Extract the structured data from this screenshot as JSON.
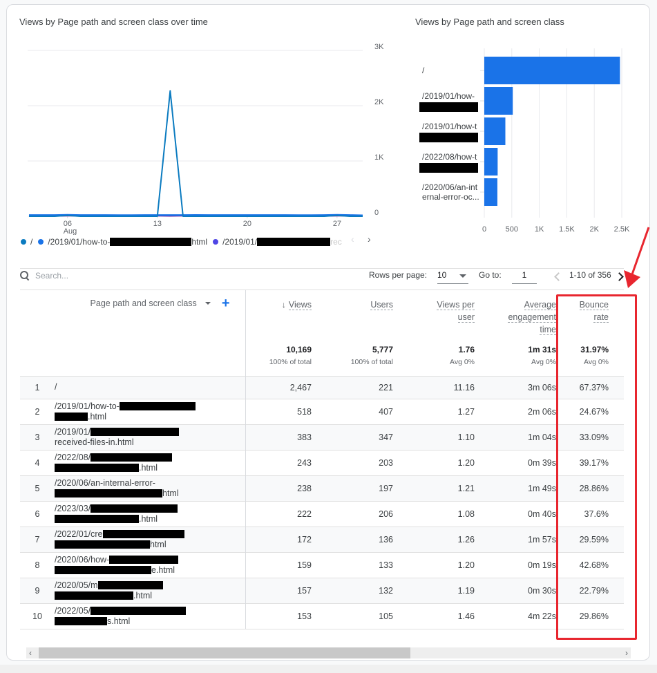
{
  "line_chart": {
    "title": "Views by Page path and screen class over time",
    "legend": [
      {
        "label_visible": "/",
        "color": "#0b7bc0"
      },
      {
        "label_prefix": "/2019/01/how-to-",
        "label_suffix": "html",
        "redacted": true,
        "color": "#1a73e8"
      },
      {
        "label_prefix": "/2019/01/",
        "label_suffix": "rec",
        "redacted": true,
        "color": "#4f46e5"
      }
    ],
    "legend_prev_icon": "‹",
    "legend_next_icon": "›"
  },
  "bar_chart": {
    "title": "Views by Page path and screen class"
  },
  "chart_data": [
    {
      "type": "line",
      "title": "Views by Page path and screen class over time",
      "x": [
        "Aug 03",
        "Aug 04",
        "Aug 05",
        "Aug 06",
        "Aug 07",
        "Aug 08",
        "Aug 09",
        "Aug 10",
        "Aug 11",
        "Aug 12",
        "Aug 13",
        "Aug 14",
        "Aug 15",
        "Aug 16",
        "Aug 17",
        "Aug 18",
        "Aug 19",
        "Aug 20",
        "Aug 21",
        "Aug 22",
        "Aug 23",
        "Aug 24",
        "Aug 25",
        "Aug 26",
        "Aug 27",
        "Aug 28",
        "Aug 29"
      ],
      "x_tick_labels": [
        {
          "x": "Aug 06",
          "label": "06",
          "sublabel": "Aug"
        },
        {
          "x": "Aug 13",
          "label": "13"
        },
        {
          "x": "Aug 20",
          "label": "20"
        },
        {
          "x": "Aug 27",
          "label": "27"
        }
      ],
      "y_ticks": [
        "0",
        "1K",
        "2K",
        "3K"
      ],
      "ylim": [
        0,
        3000
      ],
      "y_axis_side": "right",
      "grid": true,
      "series": [
        {
          "name": "/",
          "color": "#0b7bc0",
          "values": [
            0,
            0,
            0,
            15,
            0,
            0,
            0,
            0,
            0,
            0,
            0,
            2270,
            0,
            0,
            0,
            0,
            0,
            0,
            0,
            0,
            0,
            0,
            0,
            0,
            15,
            0,
            0
          ]
        },
        {
          "name": "/2019/01/how-to-…html",
          "color": "#1a73e8",
          "values": [
            20,
            20,
            20,
            25,
            20,
            20,
            20,
            18,
            18,
            20,
            20,
            20,
            20,
            22,
            20,
            20,
            20,
            20,
            20,
            20,
            20,
            18,
            18,
            20,
            25,
            20,
            15
          ]
        },
        {
          "name": "/2019/01/…rec",
          "color": "#6a1b9a",
          "values": [
            12,
            12,
            10,
            12,
            12,
            10,
            10,
            8,
            8,
            10,
            12,
            10,
            12,
            15,
            14,
            12,
            10,
            10,
            10,
            10,
            10,
            8,
            10,
            10,
            12,
            12,
            5
          ]
        }
      ]
    },
    {
      "type": "bar",
      "orientation": "horizontal",
      "title": "Views by Page path and screen class",
      "categories": [
        "/",
        "/2019/01/how-…",
        "/2019/01/how-t…",
        "/2022/08/how-t…",
        "/2020/06/an-internal-error-oc..."
      ],
      "category_labels": [
        {
          "line1": "/",
          "redacted_line2": false
        },
        {
          "line1": "/2019/01/how-",
          "redacted_line2": true
        },
        {
          "line1": "/2019/01/how-t",
          "redacted_line2": true
        },
        {
          "line1": "/2022/08/how-t",
          "redacted_line2": true
        },
        {
          "line1": "/2020/06/an-int",
          "line2": "ernal-error-oc...",
          "redacted_line2": false
        }
      ],
      "values": [
        2467,
        518,
        383,
        243,
        238
      ],
      "color": "#1a73e8",
      "x_ticks": [
        "0",
        "500",
        "1K",
        "1.5K",
        "2K",
        "2.5K"
      ],
      "xlim": [
        0,
        2500
      ],
      "grid": true
    }
  ],
  "toolbar": {
    "search_placeholder": "Search...",
    "rows_per_page_label": "Rows per page:",
    "rows_per_page_value": "10",
    "goto_label": "Go to:",
    "goto_value": "1",
    "range_text": "1-10 of 356"
  },
  "table": {
    "dimension_header": "Page path and screen class",
    "sort_icon": "↓",
    "add_icon": "+",
    "columns": [
      {
        "key": "views",
        "label": "Views",
        "lines": [
          "Views"
        ],
        "total": "10,169",
        "total_sub": "100% of total"
      },
      {
        "key": "users",
        "label": "Users",
        "lines": [
          "Users"
        ],
        "total": "5,777",
        "total_sub": "100% of total"
      },
      {
        "key": "vpu",
        "label": "Views per user",
        "lines": [
          "Views per",
          "user"
        ],
        "total": "1.76",
        "total_sub": "Avg 0%"
      },
      {
        "key": "aet",
        "label": "Average engagement time",
        "lines": [
          "Average",
          "engagement",
          "time"
        ],
        "total": "1m 31s",
        "total_sub": "Avg 0%"
      },
      {
        "key": "bounce",
        "label": "Bounce rate",
        "lines": [
          "Bounce rate"
        ],
        "total": "31.97%",
        "total_sub": "Avg 0%"
      }
    ],
    "rows": [
      {
        "index": "1",
        "path_line1": "/",
        "path_line2": "",
        "views": "2,467",
        "users": "221",
        "vpu": "11.16",
        "aet": "3m 06s",
        "bounce": "67.37%"
      },
      {
        "index": "2",
        "path_line1": "/2019/01/how-to-",
        "path_line2": ".html",
        "views": "518",
        "users": "407",
        "vpu": "1.27",
        "aet": "2m 06s",
        "bounce": "24.67%"
      },
      {
        "index": "3",
        "path_line1": "/2019/01/",
        "path_line2": "received-files-in.html",
        "views": "383",
        "users": "347",
        "vpu": "1.10",
        "aet": "1m 04s",
        "bounce": "33.09%"
      },
      {
        "index": "4",
        "path_line1": "/2022/08/",
        "path_line2": ".html",
        "views": "243",
        "users": "203",
        "vpu": "1.20",
        "aet": "0m 39s",
        "bounce": "39.17%"
      },
      {
        "index": "5",
        "path_line1": "/2020/06/an-internal-error-",
        "path_line2": "html",
        "views": "238",
        "users": "197",
        "vpu": "1.21",
        "aet": "1m 49s",
        "bounce": "28.86%"
      },
      {
        "index": "6",
        "path_line1": "/2023/03/",
        "path_line2": ".html",
        "views": "222",
        "users": "206",
        "vpu": "1.08",
        "aet": "0m 40s",
        "bounce": "37.6%"
      },
      {
        "index": "7",
        "path_line1": "/2022/01/cre",
        "path_line2": "html",
        "views": "172",
        "users": "136",
        "vpu": "1.26",
        "aet": "1m 57s",
        "bounce": "29.59%"
      },
      {
        "index": "8",
        "path_line1": "/2020/06/how-",
        "path_line2": "e.html",
        "views": "159",
        "users": "133",
        "vpu": "1.20",
        "aet": "0m 19s",
        "bounce": "42.68%"
      },
      {
        "index": "9",
        "path_line1": "/2020/05/m",
        "path_line2": ".html",
        "views": "157",
        "users": "132",
        "vpu": "1.19",
        "aet": "0m 30s",
        "bounce": "22.79%"
      },
      {
        "index": "10",
        "path_line1": "/2022/05/",
        "path_line2": "s.html",
        "views": "153",
        "users": "105",
        "vpu": "1.46",
        "aet": "4m 22s",
        "bounce": "29.86%"
      }
    ]
  },
  "annotation": {
    "highlight_color": "#e8262f",
    "highlight_target": "Bounce rate column"
  },
  "scrollbar": {
    "left_icon": "‹",
    "right_icon": "›",
    "position_fraction": 0.0,
    "visible_fraction": 0.62
  }
}
